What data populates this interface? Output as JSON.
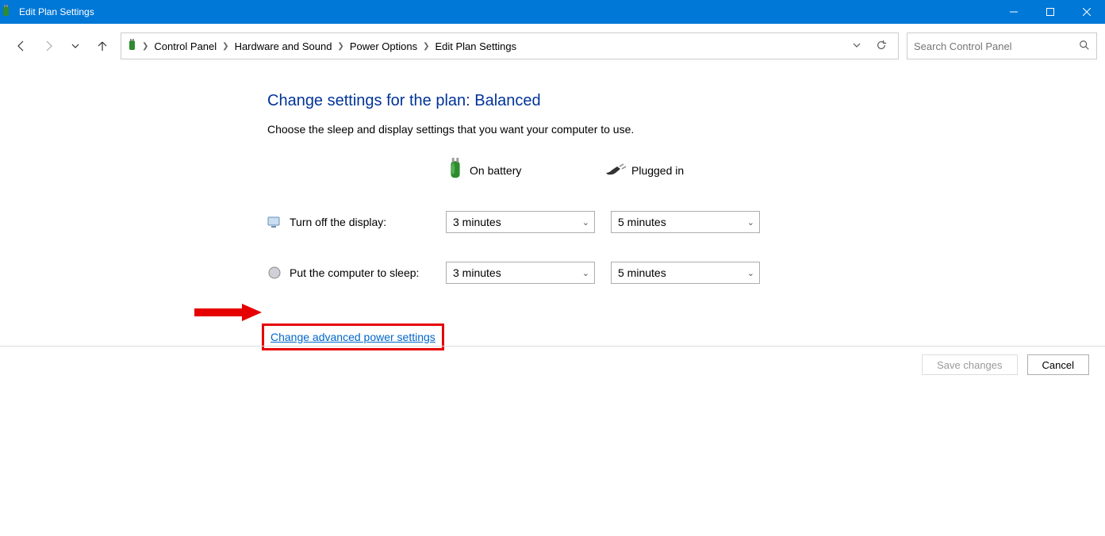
{
  "window": {
    "title": "Edit Plan Settings"
  },
  "breadcrumb": {
    "items": [
      "Control Panel",
      "Hardware and Sound",
      "Power Options",
      "Edit Plan Settings"
    ]
  },
  "search": {
    "placeholder": "Search Control Panel"
  },
  "page": {
    "heading": "Change settings for the plan: Balanced",
    "subtext": "Choose the sleep and display settings that you want your computer to use.",
    "col_battery": "On battery",
    "col_plugged": "Plugged in",
    "row_display": "Turn off the display:",
    "row_sleep": "Put the computer to sleep:",
    "display_battery": "3 minutes",
    "display_plugged": "5 minutes",
    "sleep_battery": "3 minutes",
    "sleep_plugged": "5 minutes",
    "advanced_link": "Change advanced power settings"
  },
  "footer": {
    "save": "Save changes",
    "cancel": "Cancel"
  }
}
